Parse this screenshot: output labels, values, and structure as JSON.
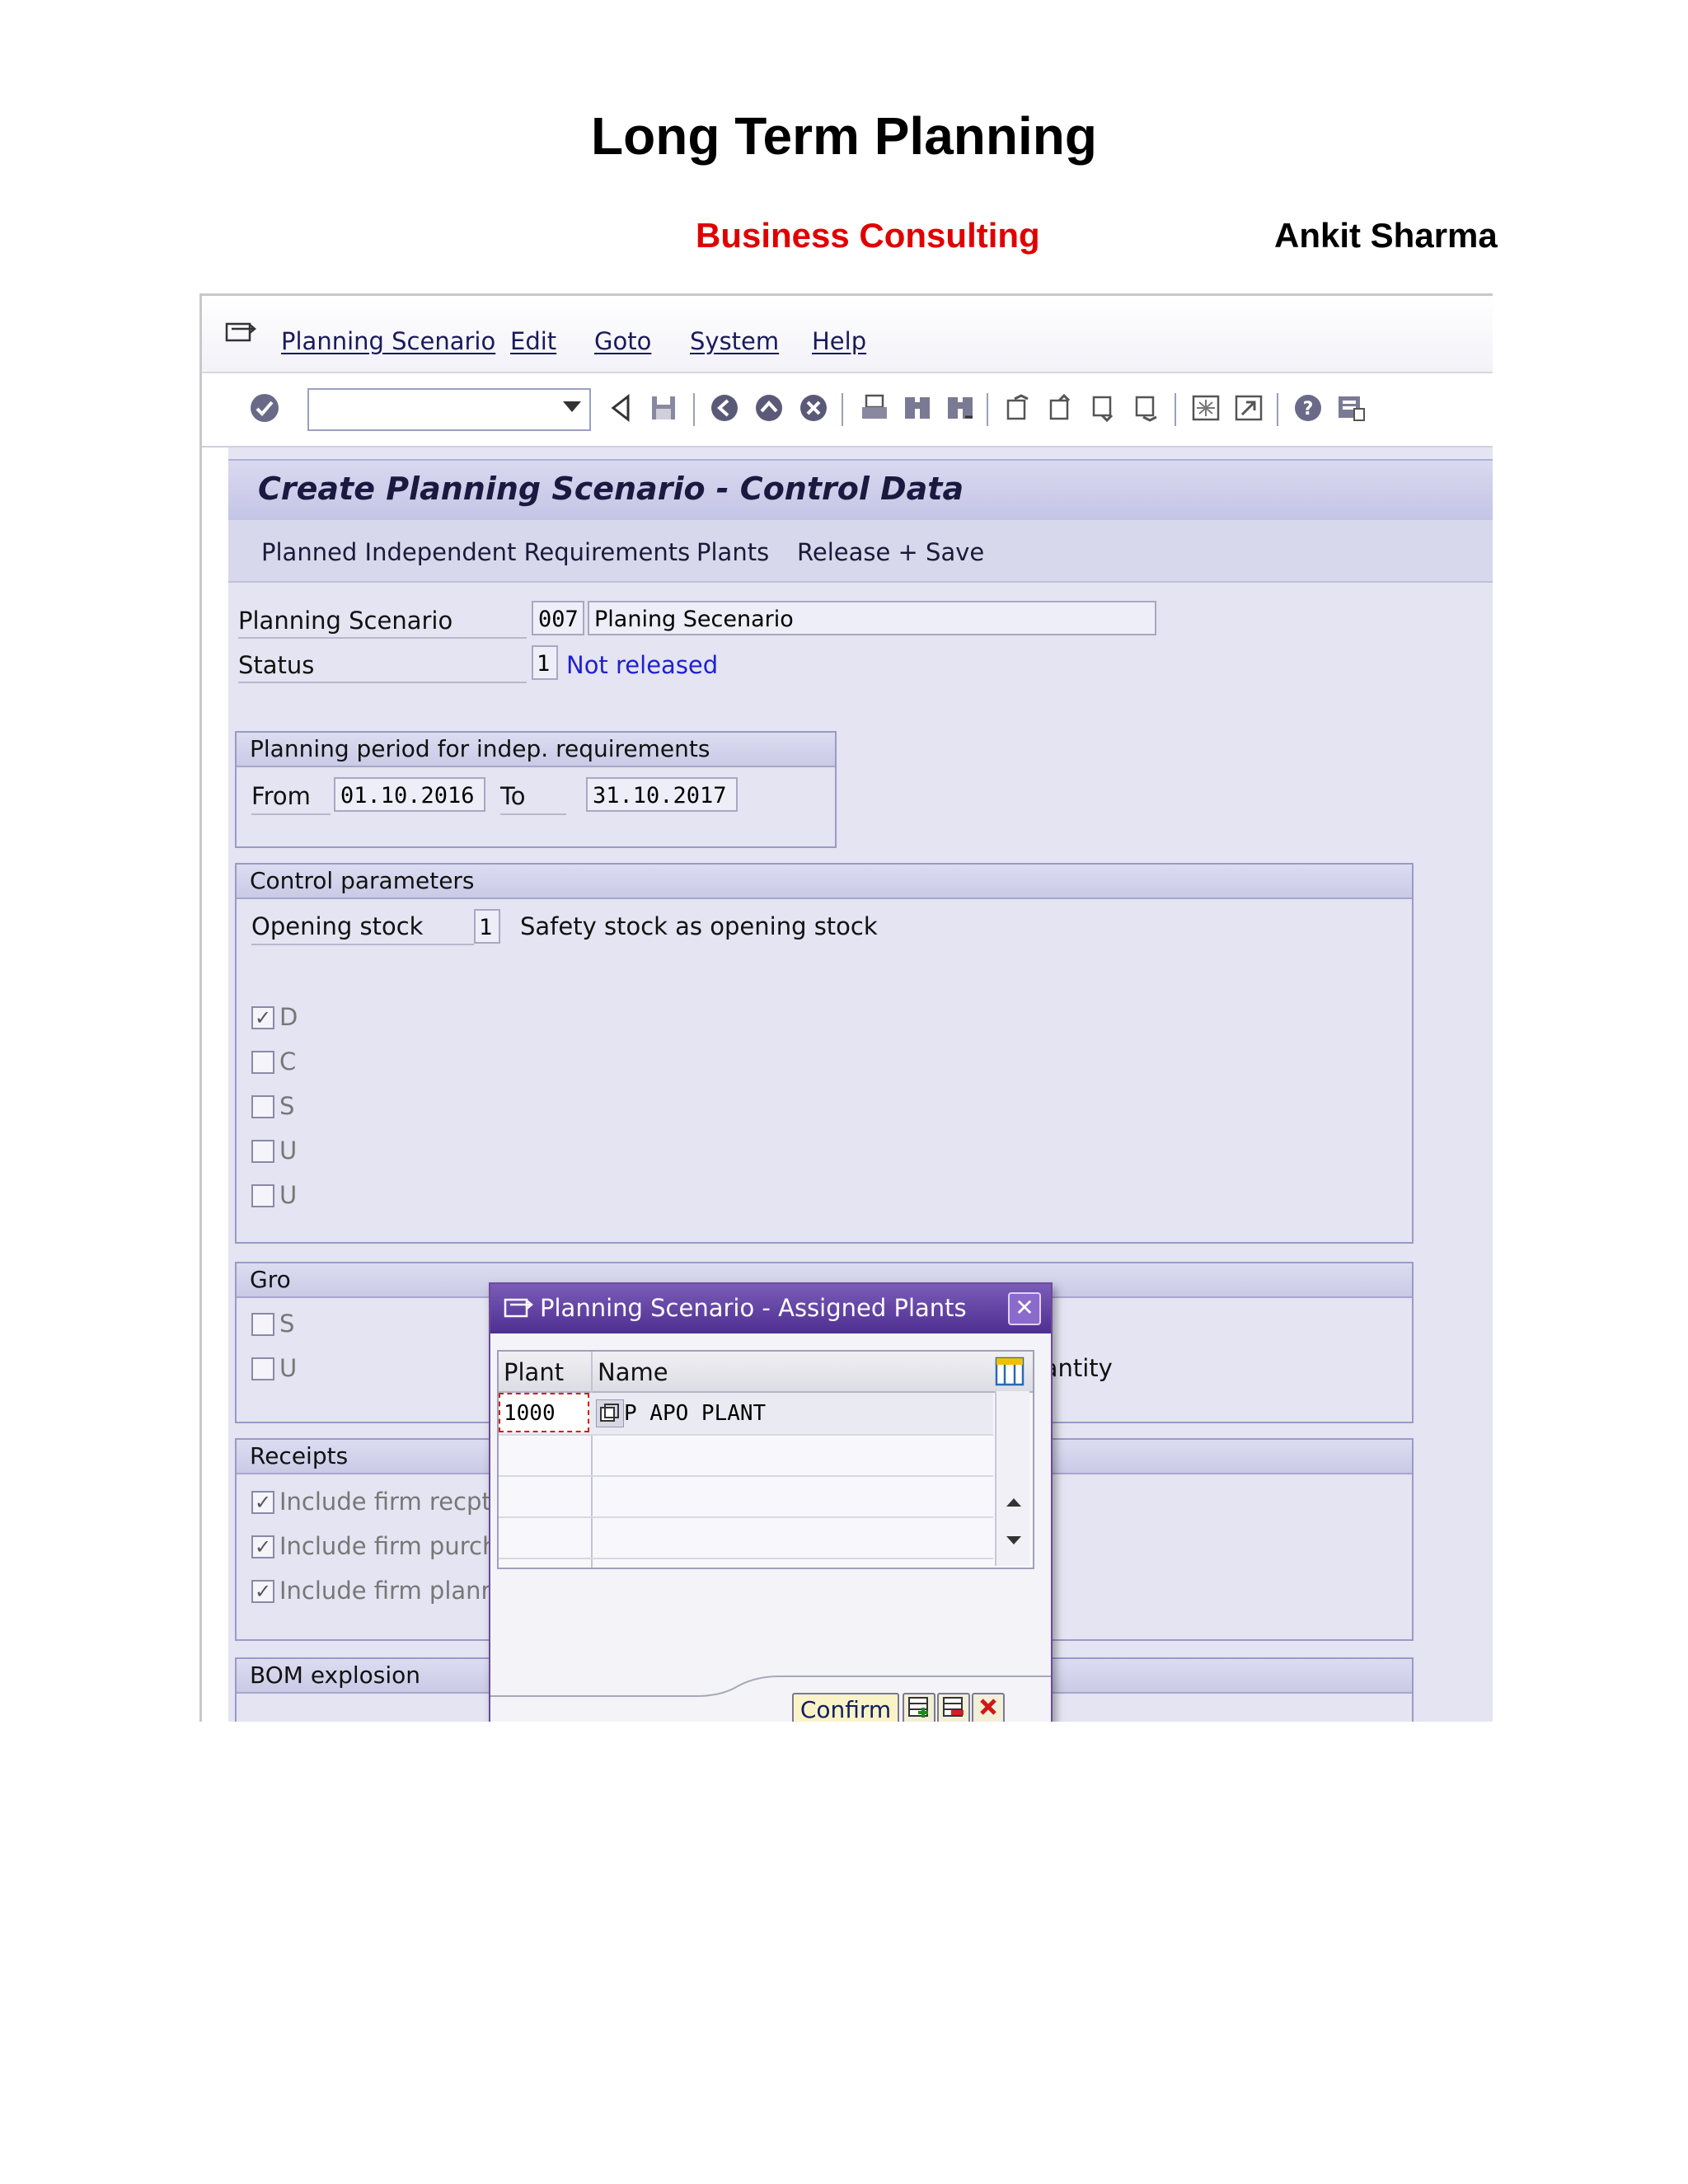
{
  "document": {
    "title": "Long Term Planning",
    "subtitle_company": "Business Consulting",
    "author": "Ankit Sharma"
  },
  "menu": {
    "items": [
      "Planning Scenario",
      "Edit",
      "Goto",
      "System",
      "Help"
    ]
  },
  "screen": {
    "title": "Create Planning Scenario - Control Data"
  },
  "app_toolbar": {
    "items": [
      "Planned Independent Requirements",
      "Plants",
      "Release + Save"
    ]
  },
  "header": {
    "planning_scenario_label": "Planning Scenario",
    "planning_scenario_code": "007",
    "planning_scenario_name": "Planing Secenario",
    "status_label": "Status",
    "status_code": "1",
    "status_text": "Not released"
  },
  "planning_period": {
    "title": "Planning period for indep. requirements",
    "from_label": "From",
    "from_value": "01.10.2016",
    "to_label": "To",
    "to_value": "31.10.2017"
  },
  "control_parameters": {
    "title": "Control parameters",
    "opening_stock_label": "Opening stock",
    "opening_stock_code": "1",
    "opening_stock_text": "Safety stock as opening stock",
    "checkbox_partial": [
      "D",
      "C",
      "S",
      "U",
      "U"
    ]
  },
  "gross_section": {
    "title_partial": "Gro",
    "checkbox_partial": [
      "S",
      "U"
    ],
    "lot_text_partial": "-for-lot order quantity"
  },
  "receipts": {
    "title_partial": "Receipts",
    "items": [
      "Include firm recpts",
      "Include firm purchase requisitions",
      "Include firm planned orders"
    ]
  },
  "bom": {
    "title": "BOM explosion"
  },
  "popup": {
    "title": "Planning Scenario - Assigned Plants",
    "columns": [
      "Plant",
      "Name"
    ],
    "rows": [
      {
        "plant": "1000",
        "name": "P APO PLANT"
      }
    ],
    "confirm_label": "Confirm"
  },
  "colors": {
    "accent_red": "#e00000",
    "status_blue": "#2020d0",
    "screen_bg": "#e4e4f2",
    "popup_title": "#5a3a9c"
  }
}
